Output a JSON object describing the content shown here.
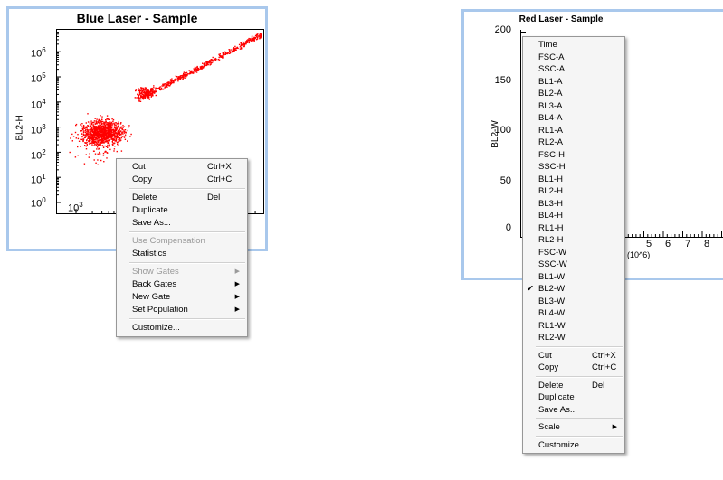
{
  "plot1": {
    "title": "Blue Laser - Sample",
    "ylabel": "BL2-H",
    "yticks": [
      {
        "base": "10",
        "exp": "6"
      },
      {
        "base": "10",
        "exp": "5"
      },
      {
        "base": "10",
        "exp": "4"
      },
      {
        "base": "10",
        "exp": "3"
      },
      {
        "base": "10",
        "exp": "2"
      },
      {
        "base": "10",
        "exp": "1"
      },
      {
        "base": "10",
        "exp": "0"
      }
    ],
    "xticks": [
      {
        "base": "10",
        "exp": "3"
      }
    ],
    "point_color": "#ff0000"
  },
  "plot2": {
    "title": "Red Laser - Sample",
    "ylabel": "BL2-W",
    "yticks": [
      "200",
      "150",
      "100",
      "50",
      "0"
    ],
    "xticks": [
      "5",
      "6",
      "7",
      "8"
    ],
    "xunit": "(10^6)"
  },
  "menu1": {
    "items": [
      {
        "label": "Cut",
        "shortcut": "Ctrl+X"
      },
      {
        "label": "Copy",
        "shortcut": "Ctrl+C"
      },
      {
        "label": "Delete",
        "shortcut": "Del"
      },
      {
        "label": "Duplicate"
      },
      {
        "label": "Save As..."
      },
      {
        "label": "Use Compensation",
        "disabled": true
      },
      {
        "label": "Statistics"
      },
      {
        "label": "Show Gates",
        "disabled": true,
        "submenu": true
      },
      {
        "label": "Back Gates",
        "submenu": true
      },
      {
        "label": "New Gate",
        "submenu": true
      },
      {
        "label": "Set Population",
        "submenu": true
      },
      {
        "label": "Customize..."
      }
    ]
  },
  "menu2": {
    "params": [
      "Time",
      "FSC-A",
      "SSC-A",
      "BL1-A",
      "BL2-A",
      "BL3-A",
      "BL4-A",
      "RL1-A",
      "RL2-A",
      "FSC-H",
      "SSC-H",
      "BL1-H",
      "BL2-H",
      "BL3-H",
      "BL4-H",
      "RL1-H",
      "RL2-H",
      "FSC-W",
      "SSC-W",
      "BL1-W",
      "BL2-W",
      "BL3-W",
      "BL4-W",
      "RL1-W",
      "RL2-W"
    ],
    "checked_param": "BL2-W",
    "check_mark": "✔",
    "actions": [
      {
        "label": "Cut",
        "shortcut": "Ctrl+X"
      },
      {
        "label": "Copy",
        "shortcut": "Ctrl+C"
      },
      {
        "label": "Delete",
        "shortcut": "Del"
      },
      {
        "label": "Duplicate"
      },
      {
        "label": "Save As..."
      },
      {
        "label": "Scale",
        "submenu": true
      },
      {
        "label": "Customize..."
      }
    ]
  },
  "submenu_arrow": "▶"
}
